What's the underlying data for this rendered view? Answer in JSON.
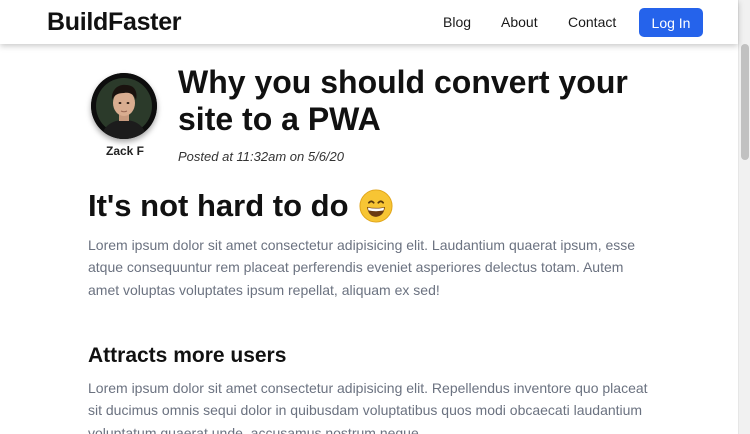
{
  "header": {
    "brand": "BuildFaster",
    "nav": {
      "blog": "Blog",
      "about": "About",
      "contact": "Contact"
    },
    "login_label": "Log In",
    "accent_color": "#2563eb"
  },
  "post": {
    "author": "Zack F",
    "title": "Why you should convert your site to a PWA",
    "meta": "Posted at 11:32am on 5/6/20",
    "sections": [
      {
        "heading": "It's not hard to do",
        "emoji": "grinning-face-icon",
        "body": "Lorem ipsum dolor sit amet consectetur adipisicing elit. Laudantium quaerat ipsum, esse atque consequuntur rem placeat perferendis eveniet asperiores delectus totam. Autem amet voluptas voluptates ipsum repellat, aliquam ex sed!"
      },
      {
        "heading": "Attracts more users",
        "body": "Lorem ipsum dolor sit amet consectetur adipisicing elit. Repellendus inventore quo placeat sit ducimus omnis sequi dolor in quibusdam voluptatibus quos modi obcaecati laudantium voluptatum quaerat unde, accusamus nostrum neque"
      }
    ]
  }
}
